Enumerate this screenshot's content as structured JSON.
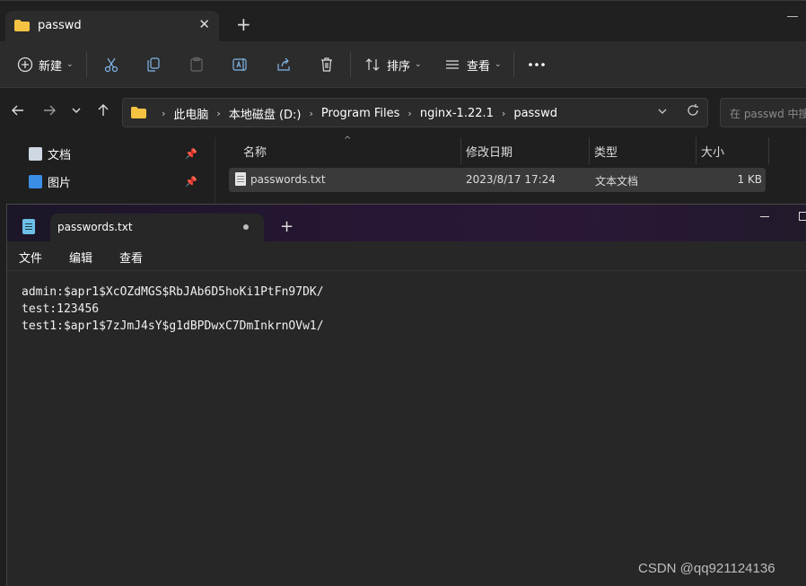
{
  "explorer": {
    "tab_title": "passwd",
    "toolbar": {
      "new_label": "新建",
      "sort_label": "排序",
      "view_label": "查看"
    },
    "breadcrumbs": [
      "此电脑",
      "本地磁盘 (D:)",
      "Program Files",
      "nginx-1.22.1",
      "passwd"
    ],
    "search_placeholder": "在 passwd 中搜",
    "sidebar": [
      {
        "label": "文档",
        "icon": "document-icon"
      },
      {
        "label": "图片",
        "icon": "picture-icon"
      }
    ],
    "columns": [
      "名称",
      "修改日期",
      "类型",
      "大小"
    ],
    "files": [
      {
        "name": "passwords.txt",
        "modified": "2023/8/17 17:24",
        "type": "文本文档",
        "size": "1 KB"
      }
    ]
  },
  "notepad": {
    "tab_title": "passwords.txt",
    "menu": [
      "文件",
      "编辑",
      "查看"
    ],
    "content": "admin:$apr1$XcOZdMGS$RbJAb6D5hoKi1PtFn97DK/\ntest:123456\ntest1:$apr1$7zJmJ4sY$g1dBPDwxC7DmInkrnOVw1/"
  },
  "watermark": "CSDN @qq921124136",
  "colors": {
    "folder": "#f5c242",
    "accent": "#6cc0e8"
  }
}
